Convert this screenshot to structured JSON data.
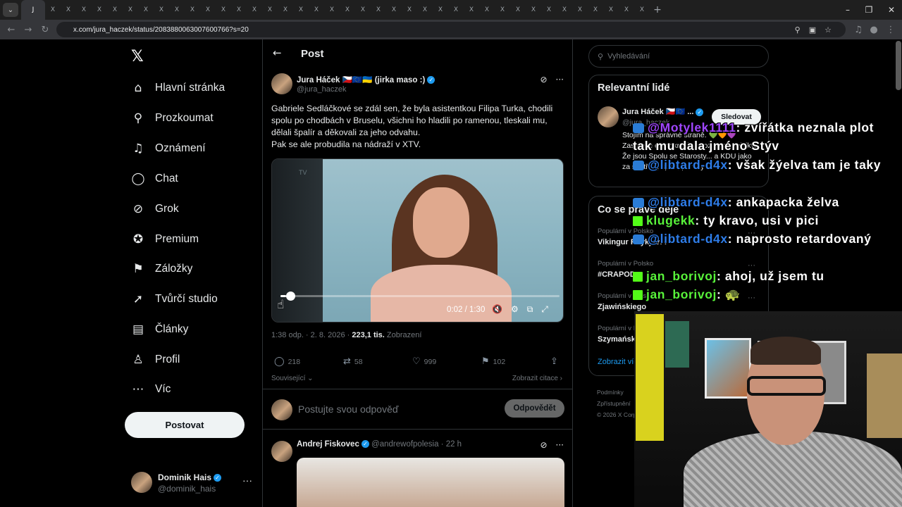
{
  "browser": {
    "tabs": [
      "J",
      "X",
      "X",
      "X",
      "X",
      "X",
      "X",
      "X",
      "X",
      "X",
      "X",
      "X",
      "X",
      "X",
      "X",
      "X",
      "X",
      "X",
      "X",
      "X",
      "X",
      "X",
      "X",
      "X",
      "X",
      "X",
      "X",
      "X",
      "X",
      "X",
      "X",
      "X",
      "X",
      "X",
      "X",
      "X",
      "X",
      "X",
      "X",
      "X"
    ],
    "new_tab": "+",
    "url": "x.com/jura_haczek/status/2083880063007600766?s=20"
  },
  "nav": {
    "items": [
      {
        "label": "Hlavní stránka",
        "icon": "home-icon",
        "glyph": "⌂"
      },
      {
        "label": "Prozkoumat",
        "icon": "search-icon",
        "glyph": "⚲"
      },
      {
        "label": "Oznámení",
        "icon": "bell-icon",
        "glyph": "♫"
      },
      {
        "label": "Chat",
        "icon": "chat-icon",
        "glyph": "◯"
      },
      {
        "label": "Grok",
        "icon": "grok-icon",
        "glyph": "⊘"
      },
      {
        "label": "Premium",
        "icon": "premium-icon",
        "glyph": "✪"
      },
      {
        "label": "Záložky",
        "icon": "bookmark-icon",
        "glyph": "⚑"
      },
      {
        "label": "Tvůrčí studio",
        "icon": "rocket-icon",
        "glyph": "➚"
      },
      {
        "label": "Články",
        "icon": "article-icon",
        "glyph": "▤"
      },
      {
        "label": "Profil",
        "icon": "profile-icon",
        "glyph": "♙"
      },
      {
        "label": "Víc",
        "icon": "more-circle-icon",
        "glyph": "⋯"
      }
    ],
    "post_button": "Postovat",
    "user": {
      "name": "Dominik Hais",
      "handle": "@dominik_hais"
    }
  },
  "post": {
    "header_title": "Post",
    "author_name": "Jura Háček 🇨🇿🇪🇺🇺🇦 (jirka maso :)",
    "author_handle": "@jura_haczek",
    "text_lines": [
      "Gabriele Sedláčkové se zdál sen, že byla asistentkou Filipa Turka, chodili",
      "spolu po chodbách v Bruselu, všichni ho hladili po ramenou, tleskali mu,",
      "dělali špalír a děkovali za jeho odvahu.",
      "Pak se ale probudila na nádraží v XTV."
    ],
    "video": {
      "time": "0:02 / 1:30",
      "progress": 0.02,
      "watermark": "TV"
    },
    "meta_time": "1:38 odp. · 2. 8. 2026 · ",
    "meta_views": "223,1 tis.",
    "meta_views_label": " Zobrazení",
    "replies": "218",
    "reposts": "58",
    "likes": "999",
    "bookmarks": "102",
    "related_label": "Související",
    "quotes_label": "Zobrazit citace",
    "reply_placeholder": "Postujte svou odpověď",
    "reply_button": "Odpovědět"
  },
  "reply2": {
    "name": "Andrej Fiskovec",
    "handle": "@andrewofpolesia · 22 h"
  },
  "sidebar": {
    "search_placeholder": "Vyhledávání",
    "relevant_title": "Relevantní lidé",
    "person": {
      "name": "Jura Háček 🇨🇿🇪🇺 ...",
      "handle": "@jura_haczek",
      "follow": "Sledovat",
      "bio": "Stojím na správné straně. 💚🧡💜 Zastánce demokracie a rozumné politiky. Že jsou Spolu se Starosty... a KDU jako za sestřihy, sport, parody"
    },
    "trends_title": "Co se právě děje",
    "trends": [
      {
        "context": "Populární v Polsko",
        "title": "Vikingur Reykjavík"
      },
      {
        "context": "Populární v Polsko",
        "title": "#CRAPOD"
      },
      {
        "context": "Populární v Polsko",
        "title": "Zjawińskiego"
      },
      {
        "context": "Populární v Polsko",
        "title": "Szymański"
      }
    ],
    "show_more": "Zobrazit více",
    "footer": [
      "Podmínky",
      "Zpřístupnění",
      "© 2026 X Corp."
    ]
  },
  "overlay_chat": [
    {
      "user": "@Motylek1111",
      "msg": ": zvířátka neznala plot tak mu dala jméno Stýv",
      "color": "#a046ff",
      "badge": "yt"
    },
    {
      "user": "@libtard-d4x",
      "msg": ": však žýelva tam je taky",
      "color": "#2e7de9",
      "badge": "yt"
    },
    {
      "user": "@libtard-d4x",
      "msg": ": ankapacka želva",
      "color": "#2e7de9",
      "badge": "yt"
    },
    {
      "user": "klugekk",
      "msg": ": ty kravo, usi v pici",
      "color": "#58f23a",
      "badge": "kick"
    },
    {
      "user": "@libtard-d4x",
      "msg": ": naprosto retardovaný",
      "color": "#2e7de9",
      "badge": "yt"
    },
    {
      "user": "jan_borivoj",
      "msg": ": ahoj, už jsem tu",
      "color": "#58f23a",
      "badge": "kick"
    },
    {
      "user": "jan_borivoj",
      "msg": ": 🐢",
      "color": "#58f23a",
      "badge": "kick"
    }
  ]
}
